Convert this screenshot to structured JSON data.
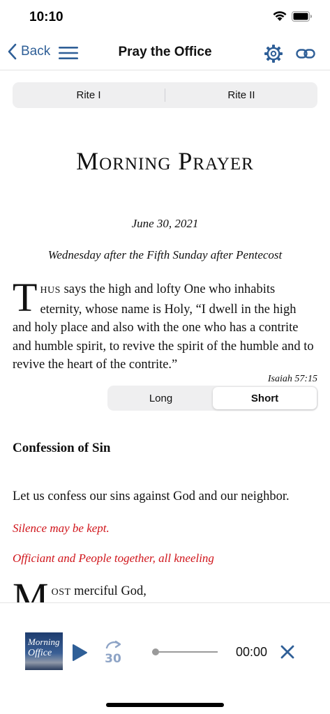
{
  "status_bar": {
    "time": "10:10"
  },
  "nav": {
    "back_label": "Back",
    "title": "Pray the Office"
  },
  "rite_tabs": [
    "Rite I",
    "Rite II"
  ],
  "office": {
    "title": "Morning Prayer",
    "date": "June 30, 2021",
    "day": "Wednesday after the Fifth Sunday after Pentecost",
    "sentence": {
      "dropcap": "T",
      "smallcaps": "HUS",
      "text": " says the high and lofty One who inhabits eternity, whose name is Holy, “I dwell in the high and holy place and also with the one who has a contrite and humble spirit, to revive the spirit of the humble and to revive the heart of the contrite.”",
      "citation": "Isaiah 57:15"
    },
    "length_toggle": {
      "options": [
        "Long",
        "Short"
      ],
      "selected": "Short"
    },
    "section_title": "Confession of Sin",
    "invitation": "Let us confess our sins against God and our neighbor.",
    "rubric_1": "Silence may be kept.",
    "rubric_2": "Officiant and People together, all kneeling",
    "prayer_start": {
      "dropcap": "M",
      "smallcaps": "OST",
      "text": " merciful God,"
    }
  },
  "player": {
    "artwork_line1": "Morning",
    "artwork_line2": "Office",
    "skip_seconds": "30",
    "elapsed": "00:00",
    "progress": 0
  },
  "colors": {
    "accent": "#2f5f97",
    "rubric": "#d0141a"
  }
}
